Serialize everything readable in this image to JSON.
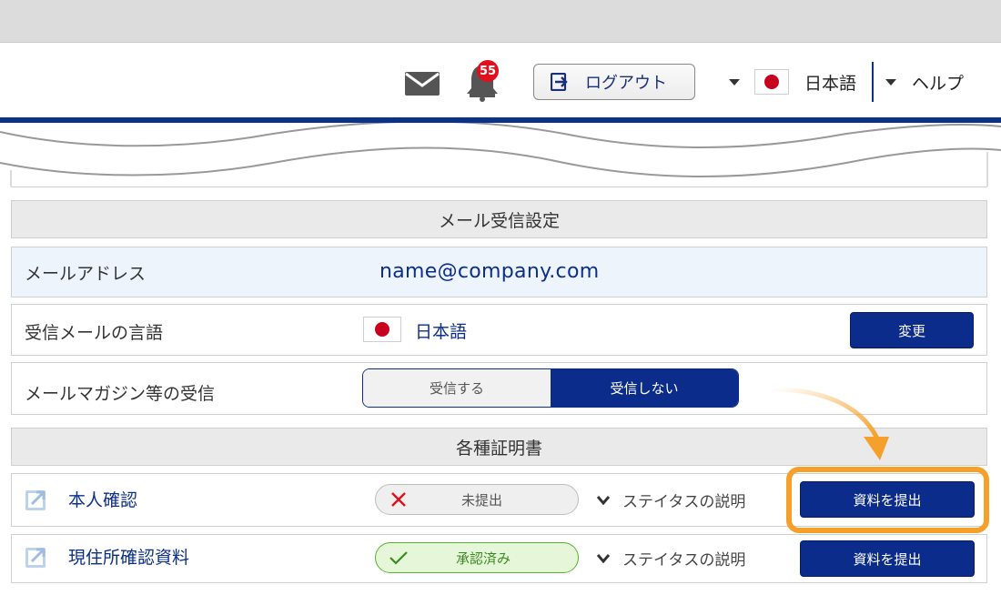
{
  "header": {
    "notification_count": "55",
    "logout_label": "ログアウト",
    "language_label": "日本語",
    "help_label": "ヘルプ"
  },
  "mail_settings": {
    "section_title": "メール受信設定",
    "email_label": "メールアドレス",
    "email_value": "name@company.com",
    "language_label": "受信メールの言語",
    "language_value": "日本語",
    "change_button": "変更",
    "magazine_label": "メールマガジン等の受信",
    "toggle_receive": "受信する",
    "toggle_no_receive": "受信しない",
    "toggle_selected": "受信しない"
  },
  "certificates": {
    "section_title": "各種証明書",
    "rows": [
      {
        "name": "本人確認",
        "status": "未提出",
        "status_help": "ステイタスの説明",
        "submit_label": "資料を提出"
      },
      {
        "name": "現住所確認資料",
        "status": "承認済み",
        "status_help": "ステイタスの説明",
        "submit_label": "資料を提出"
      }
    ]
  },
  "colors": {
    "brand_navy": "#0b2c8b",
    "highlight_orange": "#f5a02a",
    "badge_red": "#e0101e",
    "approved_green": "#56b32e",
    "error_red": "#e0101e"
  }
}
